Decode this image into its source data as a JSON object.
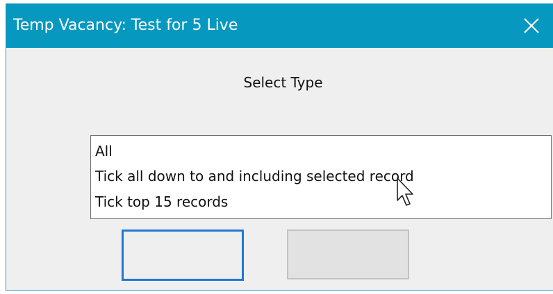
{
  "window": {
    "title": "Temp Vacancy: Test for 5 Live",
    "close_icon": "close-icon"
  },
  "dialog": {
    "heading": "Select Type"
  },
  "combo": {
    "value": "",
    "dropdown_icon": "chevron-down-icon",
    "options": [
      "All",
      "Tick all down to and including selected record",
      "Tick top 15 records"
    ]
  },
  "colors": {
    "titlebar": "#0798bf",
    "focus_border": "#2f7fd0",
    "window_bg": "#efefef"
  }
}
